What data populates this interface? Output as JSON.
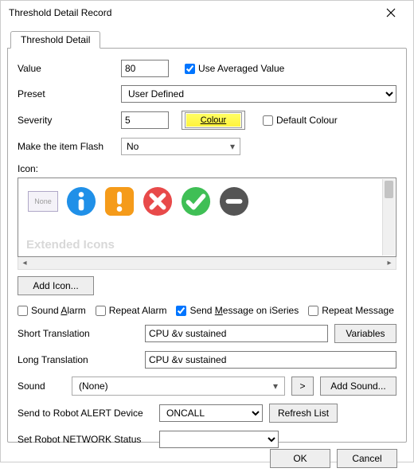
{
  "window": {
    "title": "Threshold Detail Record"
  },
  "tab": {
    "label": "Threshold Detail"
  },
  "fields": {
    "value_label": "Value",
    "value": "80",
    "use_avg_label": "Use Averaged Value",
    "preset_label": "Preset",
    "preset_value": "User Defined",
    "severity_label": "Severity",
    "severity": "5",
    "colour_label": "Colour",
    "default_colour_label": "Default Colour",
    "flash_label": "Make the item Flash",
    "flash_value": "No",
    "icon_label": "Icon:",
    "icon_none": "None",
    "extended_icons": "Extended Icons",
    "add_icon": "Add Icon...",
    "sound_alarm": "Sound Alarm",
    "repeat_alarm": "Repeat Alarm",
    "send_iseries": "Send Message on iSeries",
    "repeat_message": "Repeat Message",
    "short_trans_label": "Short Translation",
    "short_trans": "CPU &v sustained",
    "variables_btn": "Variables",
    "long_trans_label": "Long Translation",
    "long_trans": "CPU &v sustained",
    "sound_label": "Sound",
    "sound_value": "(None)",
    "play_btn": ">",
    "add_sound_btn": "Add Sound...",
    "alert_device_label": "Send to Robot ALERT Device",
    "alert_device_value": "ONCALL",
    "refresh_list": "Refresh List",
    "network_status_label": "Set Robot NETWORK Status",
    "network_status_value": ""
  },
  "footer": {
    "ok": "OK",
    "cancel": "Cancel"
  }
}
